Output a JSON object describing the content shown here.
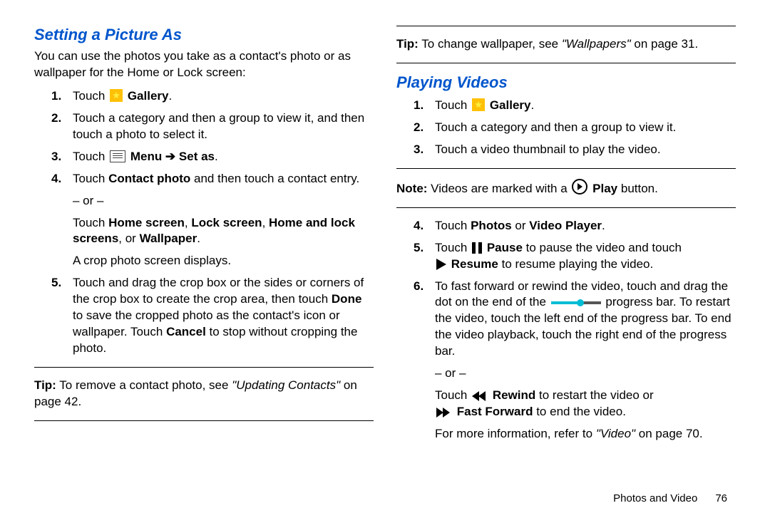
{
  "left": {
    "heading": "Setting a Picture As",
    "intro": "You can use the photos you take as a contact's photo or as wallpaper for the Home or Lock screen:",
    "step1_pre": "Touch ",
    "step1_bold": "Gallery",
    "step1_post": ".",
    "step2": "Touch a category and then a group to view it, and then touch a photo to select it.",
    "step3_pre": "Touch ",
    "step3_bold": "Menu ➔ Set as",
    "step3_post": ".",
    "step4_a": "Touch ",
    "step4_b": "Contact photo",
    "step4_c": " and then touch a contact entry.",
    "step4_or": "– or –",
    "step4_d": "Touch ",
    "step4_e": "Home screen",
    "step4_f": ", ",
    "step4_g": "Lock screen",
    "step4_h": ", ",
    "step4_i": "Home and lock screens",
    "step4_j": ", or ",
    "step4_k": "Wallpaper",
    "step4_l": ".",
    "step4_m": "A crop photo screen displays.",
    "step5_a": "Touch and drag the crop box or the sides or corners of the crop box to create the crop area, then touch ",
    "step5_b": "Done",
    "step5_c": " to save the cropped photo as the contact's icon or wallpaper. Touch ",
    "step5_d": "Cancel",
    "step5_e": " to stop without cropping the photo.",
    "tip_a": "Tip:",
    "tip_b": " To remove a contact photo, see ",
    "tip_c": "\"Updating Contacts\"",
    "tip_d": " on page 42."
  },
  "right": {
    "toptip_a": "Tip:",
    "toptip_b": " To change wallpaper, see ",
    "toptip_c": "\"Wallpapers\"",
    "toptip_d": " on page 31.",
    "heading": "Playing Videos",
    "step1_pre": "Touch ",
    "step1_bold": "Gallery",
    "step1_post": ".",
    "step2": "Touch a category and then a group to view it.",
    "step3": "Touch a video thumbnail to play the video.",
    "note_a": "Note:",
    "note_b": " Videos are marked with a ",
    "note_c": "Play",
    "note_d": " button.",
    "step4_a": "Touch ",
    "step4_b": "Photos",
    "step4_c": " or ",
    "step4_d": "Video Player",
    "step4_e": ".",
    "step5_a": "Touch ",
    "step5_b": "Pause",
    "step5_c": " to pause the video and touch ",
    "step5_d": "Resume",
    "step5_e": " to resume playing the video.",
    "step6_a": "To fast forward or rewind the video, touch and drag the dot on the end of the ",
    "step6_b": " progress bar. To restart the video, touch the left end of the progress bar. To end the video playback, touch the right end of the progress bar.",
    "step6_or": "– or –",
    "step6_c": "Touch ",
    "step6_d": "Rewind",
    "step6_e": " to restart the video or ",
    "step6_f": "Fast Forward",
    "step6_g": " to end the video.",
    "videoref_a": "For more information, refer to ",
    "videoref_b": "\"Video\"",
    "videoref_c": " on page 70.",
    "footer_section": "Photos and Video",
    "footer_page": "76"
  }
}
